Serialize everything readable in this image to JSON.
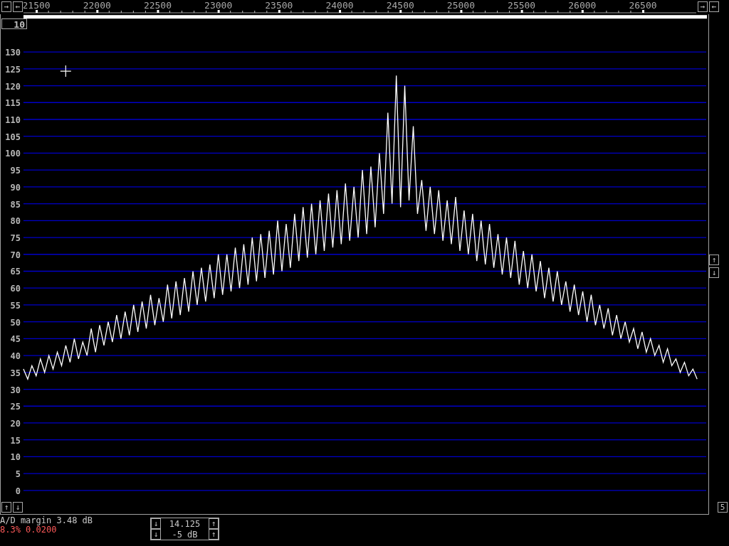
{
  "nav_buttons_left": [
    "→",
    "←"
  ],
  "nav_buttons_right": [
    "→",
    "←"
  ],
  "zoom_box": "10",
  "chart_data": {
    "type": "line",
    "xlim": [
      21394,
      27028
    ],
    "ylim": [
      0,
      130
    ],
    "grid": true,
    "x": [
      21394,
      21429,
      21464,
      21499,
      21534,
      21569,
      21604,
      21639,
      21674,
      21709,
      21744,
      21779,
      21814,
      21849,
      21884,
      21919,
      21954,
      21989,
      22024,
      22059,
      22094,
      22129,
      22164,
      22199,
      22234,
      22269,
      22304,
      22339,
      22374,
      22409,
      22444,
      22479,
      22514,
      22549,
      22584,
      22619,
      22654,
      22689,
      22724,
      22759,
      22794,
      22829,
      22864,
      22899,
      22934,
      22969,
      23004,
      23039,
      23074,
      23109,
      23144,
      23179,
      23214,
      23249,
      23284,
      23319,
      23354,
      23389,
      23424,
      23459,
      23494,
      23529,
      23564,
      23599,
      23634,
      23669,
      23704,
      23739,
      23774,
      23809,
      23844,
      23879,
      23914,
      23949,
      23984,
      24019,
      24054,
      24089,
      24124,
      24159,
      24194,
      24229,
      24264,
      24299,
      24334,
      24369,
      24404,
      24439,
      24474,
      24509,
      24544,
      24579,
      24614,
      24649,
      24684,
      24719,
      24754,
      24789,
      24824,
      24859,
      24894,
      24929,
      24964,
      24999,
      25034,
      25069,
      25104,
      25139,
      25174,
      25209,
      25244,
      25279,
      25314,
      25349,
      25384,
      25419,
      25454,
      25489,
      25524,
      25559,
      25594,
      25629,
      25664,
      25699,
      25734,
      25769,
      25804,
      25839,
      25874,
      25909,
      25944,
      25979,
      26014,
      26049,
      26084,
      26119,
      26154,
      26189,
      26224,
      26259,
      26294,
      26329,
      26364,
      26399,
      26434,
      26469,
      26504,
      26539,
      26574,
      26609,
      26644,
      26679,
      26714,
      26749,
      26784,
      26819,
      26854,
      26889,
      26924,
      26959
    ],
    "xticks": [
      21500,
      22000,
      22500,
      23000,
      23500,
      24000,
      24500,
      25000,
      25500,
      26000,
      26500
    ],
    "yticks": [
      130,
      125,
      120,
      115,
      110,
      105,
      100,
      95,
      90,
      85,
      80,
      75,
      70,
      65,
      60,
      55,
      50,
      45,
      40,
      35,
      30,
      25,
      20,
      15,
      10,
      5,
      0
    ],
    "series": [
      {
        "color": "#ffffff",
        "values": [
          36,
          33,
          37,
          34,
          39,
          35,
          40,
          36,
          41,
          37,
          43,
          38,
          45,
          39,
          44,
          40,
          48,
          41,
          49,
          43,
          50,
          44,
          52,
          45,
          53,
          46,
          55,
          47,
          56,
          48,
          58,
          49,
          57,
          50,
          61,
          51,
          62,
          52,
          63,
          53,
          65,
          55,
          66,
          56,
          67,
          57,
          70,
          58,
          70,
          59,
          72,
          60,
          73,
          61,
          75,
          62,
          76,
          63,
          77,
          64,
          80,
          65,
          79,
          66,
          82,
          68,
          84,
          69,
          85,
          70,
          86,
          71,
          88,
          72,
          89,
          73,
          91,
          74,
          90,
          75,
          95,
          76,
          96,
          78,
          100,
          82,
          112,
          85,
          123,
          84,
          120,
          86,
          108,
          82,
          92,
          77,
          90,
          76,
          89,
          74,
          86,
          73,
          87,
          71,
          83,
          70,
          82,
          68,
          80,
          67,
          79,
          66,
          76,
          64,
          75,
          63,
          74,
          61,
          71,
          60,
          70,
          59,
          68,
          57,
          66,
          56,
          65,
          55,
          62,
          53,
          61,
          52,
          59,
          50,
          58,
          49,
          55,
          48,
          54,
          46,
          52,
          45,
          50,
          44,
          48,
          42,
          47,
          41,
          45,
          40,
          43,
          38,
          42,
          37,
          39,
          35,
          38,
          34,
          36,
          33
        ]
      }
    ]
  },
  "side_buttons": [
    "↑",
    "↓"
  ],
  "bottom_left_buttons": [
    "↑",
    "↓"
  ],
  "corner_box": "5",
  "status": {
    "ad_margin": "A/D margin 3.48 dB",
    "readout": "8.3% 0.0200"
  },
  "controls": [
    {
      "down": "↓",
      "value": "14.125",
      "up": "↑"
    },
    {
      "down": "↓",
      "value": "-5 dB",
      "up": "↑"
    }
  ]
}
